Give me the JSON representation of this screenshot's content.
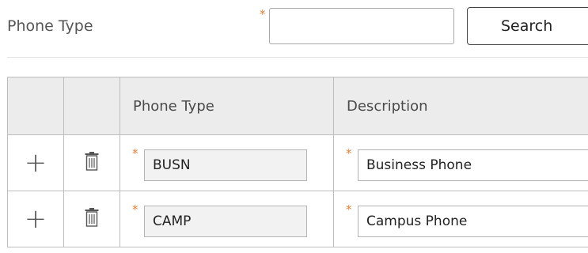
{
  "search": {
    "label": "Phone Type",
    "required_mark": "*",
    "input_value": "",
    "button_label": "Search"
  },
  "grid": {
    "columns": [
      "",
      "",
      "Phone Type",
      "Description"
    ],
    "rows": [
      {
        "add_icon": "+",
        "delete_icon": "trash-icon",
        "required_mark": "*",
        "phone_type": "BUSN",
        "description": "Business Phone"
      },
      {
        "add_icon": "+",
        "delete_icon": "trash-icon",
        "required_mark": "*",
        "phone_type": "CAMP",
        "description": "Campus Phone"
      }
    ]
  },
  "colors": {
    "required": "#e0803a",
    "header_bg": "#ececec",
    "readonly_bg": "#f2f2f2",
    "border": "#bdbdbd"
  }
}
